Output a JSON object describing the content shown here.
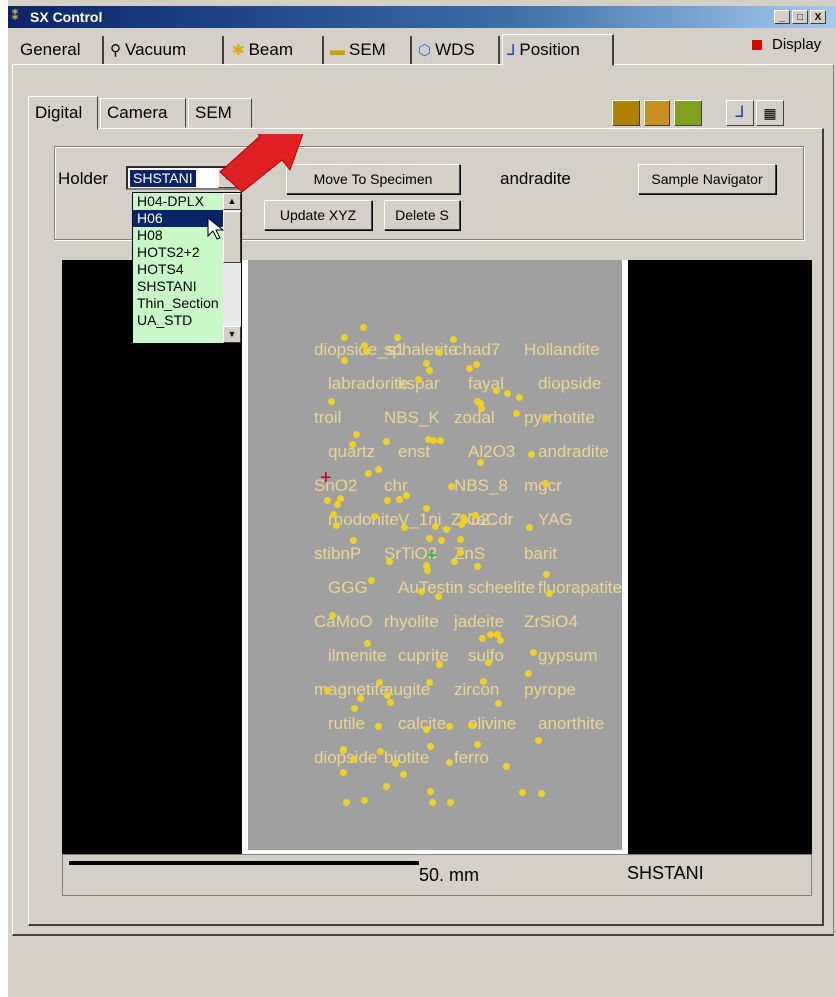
{
  "window": {
    "title": "SX Control",
    "controls": [
      "_",
      "□",
      "X"
    ]
  },
  "main_tabs": [
    {
      "label": "General",
      "icon": "none",
      "active": false
    },
    {
      "label": "Vacuum",
      "icon": "wrench-icon",
      "active": false
    },
    {
      "label": "Beam",
      "icon": "beam-icon",
      "active": false
    },
    {
      "label": "SEM",
      "icon": "sem-icon",
      "active": false
    },
    {
      "label": "WDS",
      "icon": "wds-icon",
      "active": false
    },
    {
      "label": "Position",
      "icon": "axes-icon",
      "active": true
    }
  ],
  "display_button": {
    "label": "Display"
  },
  "sub_tabs": [
    {
      "label": "Digital",
      "active": true
    },
    {
      "label": "Camera",
      "active": false
    },
    {
      "label": "SEM",
      "active": false
    }
  ],
  "holder": {
    "label": "Holder",
    "selected": "SHSTANI",
    "options": [
      "H04-DPLX",
      "H06",
      "H08",
      "HOTS2+2",
      "HOTS4",
      "SHSTANI",
      "Thin_Section",
      "UA_STD"
    ],
    "highlighted": "H06"
  },
  "buttons": {
    "move_to_specimen": "Move To Specimen",
    "update_xyz": "Update XYZ",
    "delete_s": "Delete S",
    "sample_navigator": "Sample Navigator"
  },
  "current_specimen": "andradite",
  "scale": {
    "label": "50. mm",
    "holder_name": "SHSTANI"
  },
  "map_labels": [
    "diopside_s1",
    "sphalerite",
    "chad7",
    "Hollandite",
    "labradorite",
    "kspar",
    "fayal",
    "diopside",
    "troil",
    "NBS_K",
    "zodal",
    "pyrrhotite",
    "quartz",
    "enst",
    "Al2O3",
    "andradite",
    "SnO2",
    "chr",
    "NBS_8",
    "mgcr",
    "rhodonite",
    "V_1ni_ZrO2",
    "TeCdr",
    "YAG",
    "stibnP",
    "SrTiO3",
    "ZnS",
    "barit",
    "GGG",
    "AuTestin",
    "scheelite",
    "fluorapatite",
    "CaMoO",
    "rhyolite",
    "jadeite",
    "ZrSiO4",
    "ilmenite",
    "cuprite",
    "sulfo",
    "gypsum",
    "magnetite",
    "augite",
    "zircon",
    "pyrope",
    "rutile",
    "calcite",
    "olivine",
    "anorthite",
    "diopside",
    "biotite",
    "ferro"
  ]
}
